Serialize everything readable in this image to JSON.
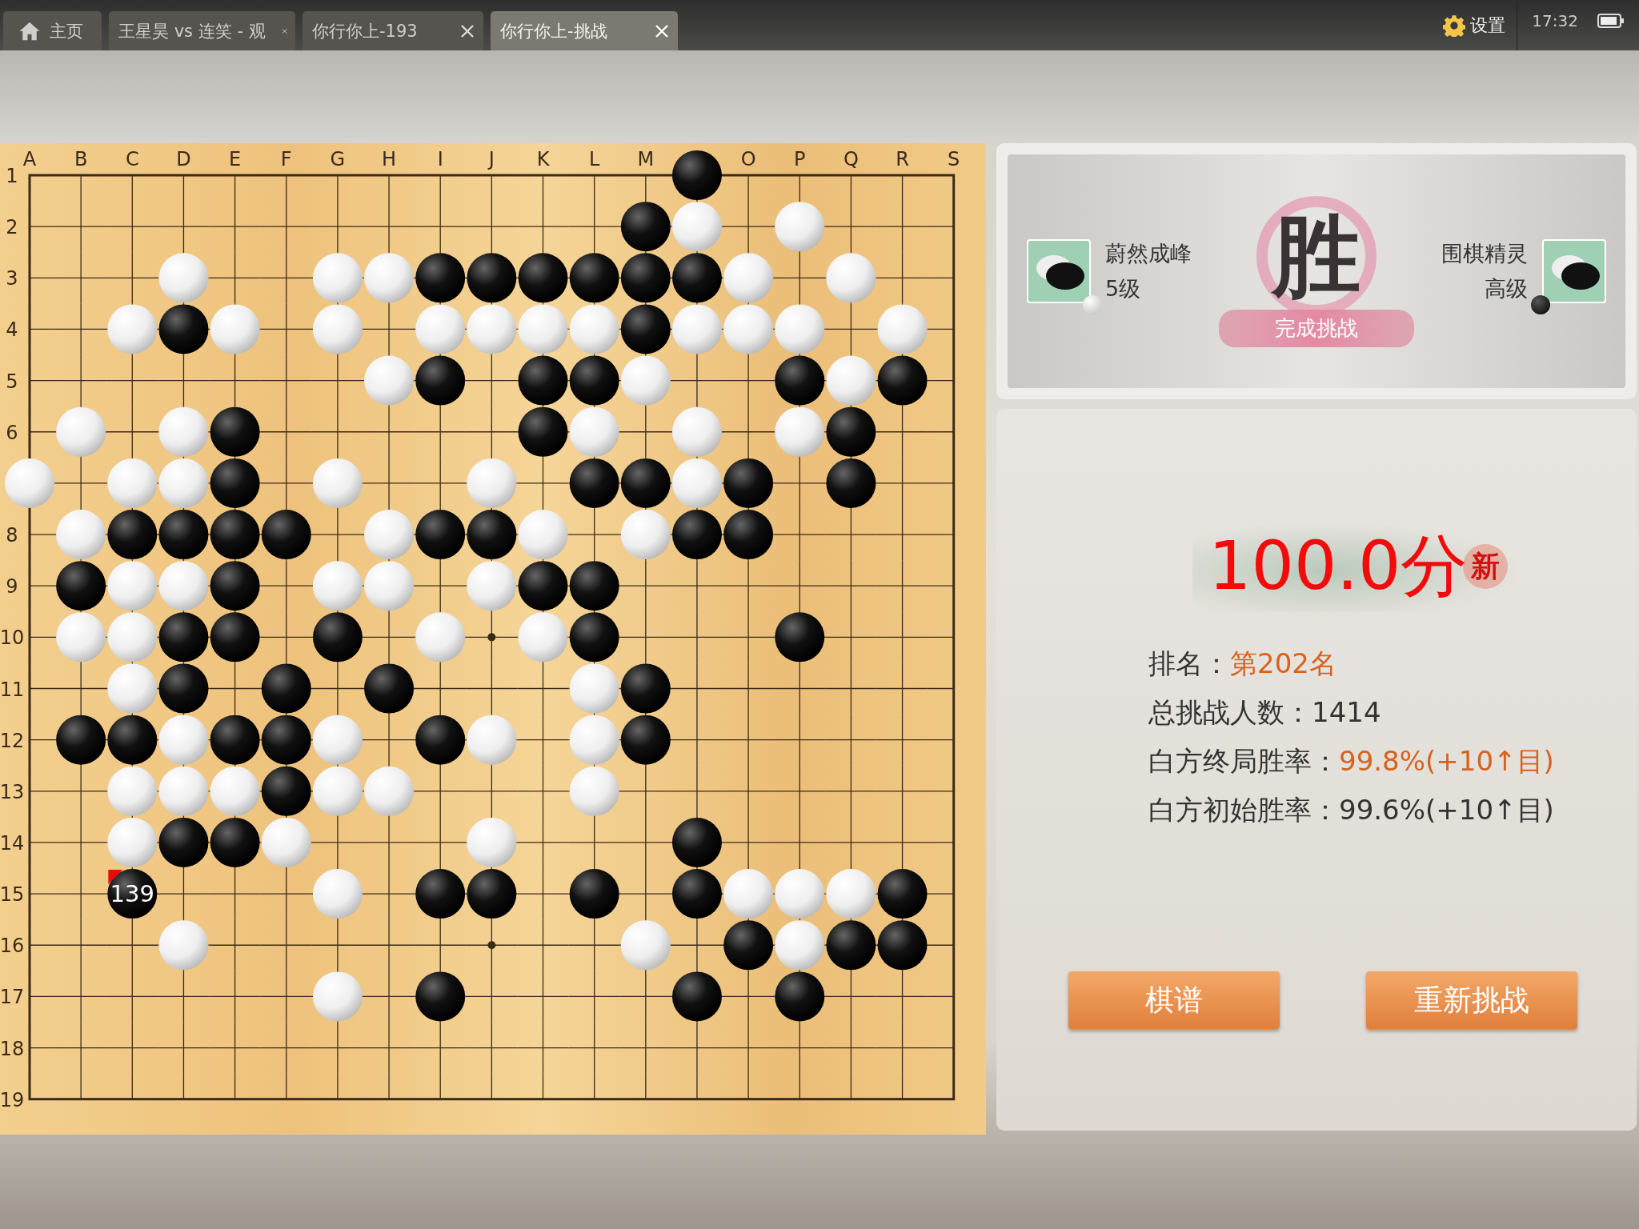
{
  "tabs": [
    {
      "kind": "home",
      "label": "主页",
      "selected": false
    },
    {
      "kind": "tab",
      "label": "王星昊 vs 连笑 - 观",
      "selected": false
    },
    {
      "kind": "tab",
      "label": "你行你上-193",
      "selected": false
    },
    {
      "kind": "tab",
      "label": "你行你上-挑战",
      "selected": true
    }
  ],
  "status": {
    "settings": "设置",
    "time": "17:32"
  },
  "board": {
    "columns": [
      {
        "label": "A"
      },
      {
        "label": "B"
      },
      {
        "label": "C"
      },
      {
        "label": "D"
      },
      {
        "label": "E"
      },
      {
        "label": "F"
      },
      {
        "label": "G"
      },
      {
        "label": "H"
      },
      {
        "label": "I"
      },
      {
        "label": "J"
      },
      {
        "label": "K"
      },
      {
        "label": "L"
      },
      {
        "label": "M"
      },
      {
        "covered": true
      },
      {
        "label": "O"
      },
      {
        "label": "P"
      },
      {
        "label": "Q"
      },
      {
        "label": "R"
      },
      {
        "label": "S"
      }
    ],
    "rows": [
      {
        "label": "1"
      },
      {
        "label": "2"
      },
      {
        "label": "3"
      },
      {
        "label": "4"
      },
      {
        "label": "5"
      },
      {
        "label": "6"
      },
      {
        "covered": true
      },
      {
        "label": "8"
      },
      {
        "label": "9"
      },
      {
        "label": "10"
      },
      {
        "label": "11"
      },
      {
        "label": "12"
      },
      {
        "label": "13"
      },
      {
        "label": "14"
      },
      {
        "label": "15"
      },
      {
        "label": "16"
      },
      {
        "label": "17"
      },
      {
        "label": "18"
      },
      {
        "label": "19"
      }
    ],
    "grid": [
      [
        {
          "stone": false
        },
        {
          "stone": false
        },
        {
          "stone": false
        },
        {
          "stone": false
        },
        {
          "stone": false
        },
        {
          "stone": false
        },
        {
          "stone": false
        },
        {
          "stone": false
        },
        {
          "stone": false
        },
        {
          "stone": false
        },
        {
          "stone": false
        },
        {
          "stone": false
        },
        {
          "stone": false
        },
        {
          "stone": true,
          "black": true
        },
        {
          "stone": false
        },
        {
          "stone": false
        },
        {
          "stone": false
        },
        {
          "stone": false
        },
        {
          "stone": false
        }
      ],
      [
        {
          "stone": false
        },
        {
          "stone": false
        },
        {
          "stone": false
        },
        {
          "stone": false
        },
        {
          "stone": false
        },
        {
          "stone": false
        },
        {
          "stone": false
        },
        {
          "stone": false
        },
        {
          "stone": false
        },
        {
          "stone": false
        },
        {
          "stone": false
        },
        {
          "stone": false
        },
        {
          "stone": true,
          "black": true
        },
        {
          "stone": true,
          "black": false
        },
        {
          "stone": false
        },
        {
          "stone": true,
          "black": false
        },
        {
          "stone": false
        },
        {
          "stone": false
        },
        {
          "stone": false
        }
      ],
      [
        {
          "stone": false
        },
        {
          "stone": false
        },
        {
          "stone": false
        },
        {
          "stone": true,
          "black": false
        },
        {
          "stone": false
        },
        {
          "stone": false
        },
        {
          "stone": true,
          "black": false
        },
        {
          "stone": true,
          "black": false
        },
        {
          "stone": true,
          "black": true
        },
        {
          "stone": true,
          "black": true
        },
        {
          "stone": true,
          "black": true
        },
        {
          "stone": true,
          "black": true
        },
        {
          "stone": true,
          "black": true
        },
        {
          "stone": true,
          "black": true
        },
        {
          "stone": true,
          "black": false
        },
        {
          "stone": false
        },
        {
          "stone": true,
          "black": false
        },
        {
          "stone": false
        },
        {
          "stone": false
        }
      ],
      [
        {
          "stone": false
        },
        {
          "stone": false
        },
        {
          "stone": true,
          "black": false
        },
        {
          "stone": true,
          "black": true
        },
        {
          "stone": true,
          "black": false
        },
        {
          "stone": false
        },
        {
          "stone": true,
          "black": false
        },
        {
          "stone": false
        },
        {
          "stone": true,
          "black": false
        },
        {
          "stone": true,
          "black": false
        },
        {
          "stone": true,
          "black": false
        },
        {
          "stone": true,
          "black": false
        },
        {
          "stone": true,
          "black": true
        },
        {
          "stone": true,
          "black": false
        },
        {
          "stone": true,
          "black": false
        },
        {
          "stone": true,
          "black": false
        },
        {
          "stone": false
        },
        {
          "stone": true,
          "black": false
        },
        {
          "stone": false
        }
      ],
      [
        {
          "stone": false
        },
        {
          "stone": false
        },
        {
          "stone": false
        },
        {
          "stone": false
        },
        {
          "stone": false
        },
        {
          "stone": false
        },
        {
          "stone": false
        },
        {
          "stone": true,
          "black": false
        },
        {
          "stone": true,
          "black": true
        },
        {
          "stone": false
        },
        {
          "stone": true,
          "black": true
        },
        {
          "stone": true,
          "black": true
        },
        {
          "stone": true,
          "black": false
        },
        {
          "stone": false
        },
        {
          "stone": false
        },
        {
          "stone": true,
          "black": true
        },
        {
          "stone": true,
          "black": false
        },
        {
          "stone": true,
          "black": true
        },
        {
          "stone": false
        }
      ],
      [
        {
          "stone": false
        },
        {
          "stone": true,
          "black": false
        },
        {
          "stone": false
        },
        {
          "stone": true,
          "black": false
        },
        {
          "stone": true,
          "black": true
        },
        {
          "stone": false
        },
        {
          "stone": false
        },
        {
          "stone": false
        },
        {
          "stone": false
        },
        {
          "stone": false
        },
        {
          "stone": true,
          "black": true
        },
        {
          "stone": true,
          "black": false
        },
        {
          "stone": false
        },
        {
          "stone": true,
          "black": false
        },
        {
          "stone": false
        },
        {
          "stone": true,
          "black": false
        },
        {
          "stone": true,
          "black": true
        },
        {
          "stone": false
        },
        {
          "stone": false
        }
      ],
      [
        {
          "stone": true,
          "black": false
        },
        {
          "stone": false
        },
        {
          "stone": true,
          "black": false
        },
        {
          "stone": true,
          "black": false
        },
        {
          "stone": true,
          "black": true
        },
        {
          "stone": false
        },
        {
          "stone": true,
          "black": false
        },
        {
          "stone": false
        },
        {
          "stone": false
        },
        {
          "stone": true,
          "black": false
        },
        {
          "stone": false
        },
        {
          "stone": true,
          "black": true
        },
        {
          "stone": true,
          "black": true
        },
        {
          "stone": true,
          "black": false
        },
        {
          "stone": true,
          "black": true
        },
        {
          "stone": false
        },
        {
          "stone": true,
          "black": true
        },
        {
          "stone": false
        },
        {
          "stone": false
        }
      ],
      [
        {
          "stone": false
        },
        {
          "stone": true,
          "black": false
        },
        {
          "stone": true,
          "black": true
        },
        {
          "stone": true,
          "black": true
        },
        {
          "stone": true,
          "black": true
        },
        {
          "stone": true,
          "black": true
        },
        {
          "stone": false
        },
        {
          "stone": true,
          "black": false
        },
        {
          "stone": true,
          "black": true
        },
        {
          "stone": true,
          "black": true
        },
        {
          "stone": true,
          "black": false
        },
        {
          "stone": false
        },
        {
          "stone": true,
          "black": false
        },
        {
          "stone": true,
          "black": true
        },
        {
          "stone": true,
          "black": true
        },
        {
          "stone": false
        },
        {
          "stone": false
        },
        {
          "stone": false
        },
        {
          "stone": false
        }
      ],
      [
        {
          "stone": false
        },
        {
          "stone": true,
          "black": true
        },
        {
          "stone": true,
          "black": false
        },
        {
          "stone": true,
          "black": false
        },
        {
          "stone": true,
          "black": true
        },
        {
          "stone": false
        },
        {
          "stone": true,
          "black": false
        },
        {
          "stone": true,
          "black": false
        },
        {
          "stone": false
        },
        {
          "stone": true,
          "black": false
        },
        {
          "stone": true,
          "black": true
        },
        {
          "stone": true,
          "black": true
        },
        {
          "stone": false
        },
        {
          "stone": false
        },
        {
          "stone": false
        },
        {
          "stone": false
        },
        {
          "stone": false
        },
        {
          "stone": false
        },
        {
          "stone": false
        }
      ],
      [
        {
          "stone": false
        },
        {
          "stone": true,
          "black": false
        },
        {
          "stone": true,
          "black": false
        },
        {
          "stone": true,
          "black": true
        },
        {
          "stone": true,
          "black": true
        },
        {
          "stone": false
        },
        {
          "stone": true,
          "black": true
        },
        {
          "stone": false
        },
        {
          "stone": true,
          "black": false
        },
        {
          "stone": false
        },
        {
          "stone": true,
          "black": false
        },
        {
          "stone": true,
          "black": true
        },
        {
          "stone": false
        },
        {
          "stone": false
        },
        {
          "stone": false
        },
        {
          "stone": true,
          "black": true
        },
        {
          "stone": false
        },
        {
          "stone": false
        },
        {
          "stone": false
        }
      ],
      [
        {
          "stone": false
        },
        {
          "stone": false
        },
        {
          "stone": true,
          "black": false
        },
        {
          "stone": true,
          "black": true
        },
        {
          "stone": false
        },
        {
          "stone": true,
          "black": true
        },
        {
          "stone": false
        },
        {
          "stone": true,
          "black": true
        },
        {
          "stone": false
        },
        {
          "stone": false
        },
        {
          "stone": false
        },
        {
          "stone": true,
          "black": false
        },
        {
          "stone": true,
          "black": true
        },
        {
          "stone": false
        },
        {
          "stone": false
        },
        {
          "stone": false
        },
        {
          "stone": false
        },
        {
          "stone": false
        },
        {
          "stone": false
        }
      ],
      [
        {
          "stone": false
        },
        {
          "stone": true,
          "black": true
        },
        {
          "stone": true,
          "black": true
        },
        {
          "stone": true,
          "black": false
        },
        {
          "stone": true,
          "black": true
        },
        {
          "stone": true,
          "black": true
        },
        {
          "stone": true,
          "black": false
        },
        {
          "stone": false
        },
        {
          "stone": true,
          "black": true
        },
        {
          "stone": true,
          "black": false
        },
        {
          "stone": false
        },
        {
          "stone": true,
          "black": false
        },
        {
          "stone": true,
          "black": true
        },
        {
          "stone": false
        },
        {
          "stone": false
        },
        {
          "stone": false
        },
        {
          "stone": false
        },
        {
          "stone": false
        },
        {
          "stone": false
        }
      ],
      [
        {
          "stone": false
        },
        {
          "stone": false
        },
        {
          "stone": true,
          "black": false
        },
        {
          "stone": true,
          "black": false
        },
        {
          "stone": true,
          "black": false
        },
        {
          "stone": true,
          "black": true
        },
        {
          "stone": true,
          "black": false
        },
        {
          "stone": true,
          "black": false
        },
        {
          "stone": false
        },
        {
          "stone": false
        },
        {
          "stone": false
        },
        {
          "stone": true,
          "black": false
        },
        {
          "stone": false
        },
        {
          "stone": false
        },
        {
          "stone": false
        },
        {
          "stone": false
        },
        {
          "stone": false
        },
        {
          "stone": false
        },
        {
          "stone": false
        }
      ],
      [
        {
          "stone": false
        },
        {
          "stone": false
        },
        {
          "stone": true,
          "black": false
        },
        {
          "stone": true,
          "black": true
        },
        {
          "stone": true,
          "black": true
        },
        {
          "stone": true,
          "black": false
        },
        {
          "stone": false
        },
        {
          "stone": false
        },
        {
          "stone": false
        },
        {
          "stone": true,
          "black": false
        },
        {
          "stone": false
        },
        {
          "stone": false
        },
        {
          "stone": false
        },
        {
          "stone": true,
          "black": true
        },
        {
          "stone": false
        },
        {
          "stone": false
        },
        {
          "stone": false
        },
        {
          "stone": false
        },
        {
          "stone": false
        }
      ],
      [
        {
          "stone": false
        },
        {
          "stone": false
        },
        {
          "stone": true,
          "black": true,
          "last_move": "139"
        },
        {
          "stone": false
        },
        {
          "stone": false
        },
        {
          "stone": false
        },
        {
          "stone": true,
          "black": false
        },
        {
          "stone": false
        },
        {
          "stone": true,
          "black": true
        },
        {
          "stone": true,
          "black": true
        },
        {
          "stone": false
        },
        {
          "stone": true,
          "black": true
        },
        {
          "stone": false
        },
        {
          "stone": true,
          "black": true
        },
        {
          "stone": true,
          "black": false
        },
        {
          "stone": true,
          "black": false
        },
        {
          "stone": true,
          "black": false
        },
        {
          "stone": true,
          "black": true
        },
        {
          "stone": false
        }
      ],
      [
        {
          "stone": false
        },
        {
          "stone": false
        },
        {
          "stone": false
        },
        {
          "stone": true,
          "black": false
        },
        {
          "stone": false
        },
        {
          "stone": false
        },
        {
          "stone": false
        },
        {
          "stone": false
        },
        {
          "stone": false
        },
        {
          "stone": false
        },
        {
          "stone": false
        },
        {
          "stone": false
        },
        {
          "stone": true,
          "black": false
        },
        {
          "stone": false
        },
        {
          "stone": true,
          "black": true
        },
        {
          "stone": true,
          "black": false
        },
        {
          "stone": true,
          "black": true
        },
        {
          "stone": true,
          "black": true
        },
        {
          "stone": false
        }
      ],
      [
        {
          "stone": false
        },
        {
          "stone": false
        },
        {
          "stone": false
        },
        {
          "stone": false
        },
        {
          "stone": false
        },
        {
          "stone": false
        },
        {
          "stone": true,
          "black": false
        },
        {
          "stone": false
        },
        {
          "stone": true,
          "black": true
        },
        {
          "stone": false
        },
        {
          "stone": false
        },
        {
          "stone": false
        },
        {
          "stone": false
        },
        {
          "stone": true,
          "black": true
        },
        {
          "stone": false
        },
        {
          "stone": true,
          "black": true
        },
        {
          "stone": false
        },
        {
          "stone": false
        },
        {
          "stone": false
        }
      ],
      [
        {
          "stone": false
        },
        {
          "stone": false
        },
        {
          "stone": false
        },
        {
          "stone": false
        },
        {
          "stone": false
        },
        {
          "stone": false
        },
        {
          "stone": false
        },
        {
          "stone": false
        },
        {
          "stone": false
        },
        {
          "stone": false
        },
        {
          "stone": false
        },
        {
          "stone": false
        },
        {
          "stone": false
        },
        {
          "stone": false
        },
        {
          "stone": false
        },
        {
          "stone": false
        },
        {
          "stone": false
        },
        {
          "stone": false
        },
        {
          "stone": false
        }
      ],
      [
        {
          "stone": false
        },
        {
          "stone": false
        },
        {
          "stone": false
        },
        {
          "stone": false
        },
        {
          "stone": false
        },
        {
          "stone": false
        },
        {
          "stone": false
        },
        {
          "stone": false
        },
        {
          "stone": false
        },
        {
          "stone": false
        },
        {
          "stone": false
        },
        {
          "stone": false
        },
        {
          "stone": false
        },
        {
          "stone": false
        },
        {
          "stone": false
        },
        {
          "stone": false
        },
        {
          "stone": false
        },
        {
          "stone": false
        },
        {
          "stone": false
        }
      ]
    ]
  },
  "result": {
    "players": [
      {
        "name": "蔚然成峰",
        "rank": "5级",
        "black": false
      },
      {
        "name": "围棋精灵",
        "rank": "高级",
        "black": true
      }
    ],
    "verdict": "胜",
    "caption": "完成挑战"
  },
  "score": {
    "value": "100.0分",
    "badge": "新",
    "stats": [
      {
        "label": "排名：",
        "value": "第202名",
        "highlight": true
      },
      {
        "label": "总挑战人数：",
        "value": "1414",
        "highlight": false
      },
      {
        "label": "白方终局胜率：",
        "value": "99.8%(+10↑目)",
        "highlight": true
      },
      {
        "label": "白方初始胜率：",
        "value": "99.6%(+10↑目)",
        "highlight": false
      }
    ]
  },
  "buttons": [
    "棋谱",
    "重新挑战"
  ]
}
